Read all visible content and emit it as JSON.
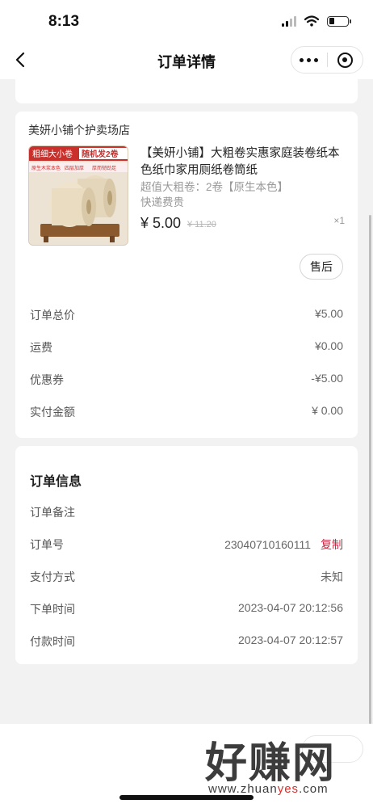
{
  "status_bar": {
    "time": "8:13"
  },
  "nav": {
    "title": "订单详情"
  },
  "shop": {
    "name": "美妍小铺个护卖场店"
  },
  "product": {
    "title": "【美妍小铺】大粗卷实惠家庭装卷纸本色纸巾家用厕纸卷筒纸",
    "spec": "超值大粗卷：2卷【原生本色】快递费贵",
    "price": "¥ 5.00",
    "original_price": "¥ 11.20",
    "quantity": "×1",
    "thumb_banner": "粗细大小卷",
    "thumb_banner2": "随机发2卷",
    "thumb_sub1": "原生木浆本色",
    "thumb_sub2": "四层加厚",
    "thumb_sub3": "厚而韧劲足"
  },
  "buttons": {
    "after_sale": "售后"
  },
  "summary": [
    {
      "label": "订单总价",
      "value": "¥5.00"
    },
    {
      "label": "运费",
      "value": "¥0.00"
    },
    {
      "label": "优惠券",
      "value": "-¥5.00"
    },
    {
      "label": "实付金额",
      "value": "¥ 0.00"
    }
  ],
  "order_info": {
    "title": "订单信息",
    "remark_label": "订单备注",
    "order_no_label": "订单号",
    "order_no": "23040710160111",
    "copy_label": "复制",
    "payment_label": "支付方式",
    "payment_value": "未知",
    "created_label": "下单时间",
    "created_value": "2023-04-07 20:12:56",
    "paid_label": "付款时间",
    "paid_value": "2023-04-07 20:12:57"
  },
  "watermark": {
    "big": "好赚网",
    "small_pre": "www.zhuan",
    "small_hl": "yes",
    "small_post": ".com"
  }
}
